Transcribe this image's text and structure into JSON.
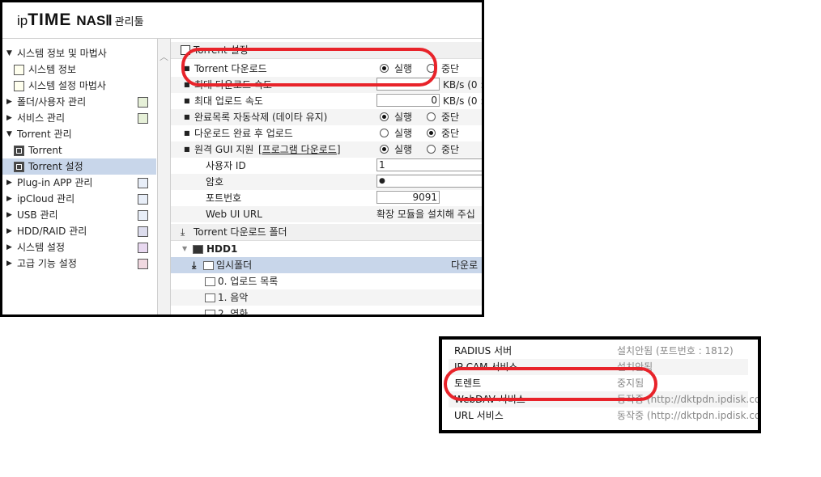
{
  "logo": {
    "ip": "ip",
    "time": "TIME",
    "nas": "NASⅡ",
    "suffix": "관리툴"
  },
  "sidebar": {
    "items": [
      {
        "label": "시스템 정보 및 마법사",
        "kind": "group",
        "open": true
      },
      {
        "label": "시스템 정보",
        "kind": "child"
      },
      {
        "label": "시스템 설정 마법사",
        "kind": "child"
      },
      {
        "label": "폴더/사용자 관리",
        "kind": "group"
      },
      {
        "label": "서비스 관리",
        "kind": "group"
      },
      {
        "label": "Torrent 관리",
        "kind": "group",
        "open": true
      },
      {
        "label": "Torrent",
        "kind": "child"
      },
      {
        "label": "Torrent 설정",
        "kind": "child",
        "selected": true
      },
      {
        "label": "Plug-in APP 관리",
        "kind": "group"
      },
      {
        "label": "ipCloud 관리",
        "kind": "group"
      },
      {
        "label": "USB 관리",
        "kind": "group"
      },
      {
        "label": "HDD/RAID 관리",
        "kind": "group"
      },
      {
        "label": "시스템 설정",
        "kind": "group"
      },
      {
        "label": "고급 기능 설정",
        "kind": "group"
      }
    ]
  },
  "torrent_settings": {
    "section_title": "Torrent 설정",
    "rows": [
      {
        "label": "Torrent 다운로드",
        "opt1": "실행",
        "opt2": "중단",
        "selected": "실행"
      },
      {
        "label": "최대 다운로드 속도",
        "unit": "KB/s (0 :"
      },
      {
        "label": "최대 업로드 속도",
        "value": "0",
        "unit": "KB/s (0 :"
      },
      {
        "label": "완료목록 자동삭제 (데이타 유지)",
        "opt1": "실행",
        "opt2": "중단",
        "selected": "실행"
      },
      {
        "label": "다운로드 완료 후 업로드",
        "opt1": "실행",
        "opt2": "중단",
        "selected": "중단"
      },
      {
        "label": "원격 GUI 지원",
        "link": "[프로그램 다운로드]",
        "opt1": "실행",
        "opt2": "중단",
        "selected": "실행"
      }
    ],
    "user_id_label": "사용자 ID",
    "user_id_value": "1",
    "password_label": "암호",
    "password_value": "●",
    "port_label": "포트번호",
    "port_value": "9091",
    "webui_label": "Web UI URL",
    "webui_value": "확장 모듈을 설치해 주십"
  },
  "download_folder": {
    "section_title": "Torrent 다운로드 폴더",
    "disk": "HDD1",
    "temp_folder": "임시폴더",
    "temp_folder_status": "다운로",
    "folders": [
      "0. 업로드 목록",
      "1. 음악",
      "2. 영화"
    ]
  },
  "services": {
    "rows": [
      {
        "name": "RADIUS 서버",
        "status": "설치안됨 (포트번호 : 1812)"
      },
      {
        "name": "IP CAM 서비스",
        "status": "설치안됨"
      },
      {
        "name": "토렌트",
        "status": "중지됨"
      },
      {
        "name": "WebDAV 서비스",
        "status": "동작중 (http://dktpdn.ipdisk.co"
      },
      {
        "name": "URL 서비스",
        "status": "동작중 (http://dktpdn.ipdisk.co"
      }
    ]
  },
  "colors": {
    "annotation": "#e8232a",
    "selected_row": "#c8d6ea",
    "section_bg": "#f0f0f0"
  },
  "icons": [
    "expand-triangle-icon",
    "collapse-triangle-icon",
    "chart-icon",
    "torrent-icon",
    "folder-icon",
    "download-icon",
    "disk-icon",
    "scroll-up-icon"
  ]
}
